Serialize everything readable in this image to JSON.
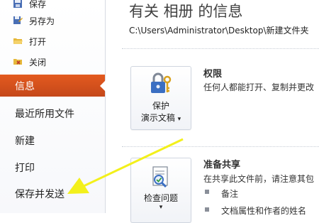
{
  "sidebar": {
    "save_label": "保存",
    "save_as_label": "另存为",
    "open_label": "打开",
    "close_label": "关闭",
    "info_label": "信息",
    "recent_label": "最近所用文件",
    "new_label": "新建",
    "print_label": "打印",
    "save_send_label": "保存并发送"
  },
  "main": {
    "title": "有关 相册 的信息",
    "path": "C:\\Users\\Administrator\\Desktop\\新建文件夹",
    "protect": {
      "tile_line1": "保护",
      "tile_line2": "演示文稿",
      "dropdown_glyph": "▾",
      "heading": "权限",
      "description": "任何人都能打开、复制并更改"
    },
    "prepare": {
      "tile_line1": "检查问题",
      "dropdown_glyph": "▾",
      "heading": "准备共享",
      "description": "在共享此文件前，请注意其包",
      "bullets": [
        "备注",
        "文档属性和作者的姓名"
      ]
    }
  },
  "colors": {
    "selected_bg": "#d9531c",
    "annotation_arrow": "#f3f01b"
  }
}
